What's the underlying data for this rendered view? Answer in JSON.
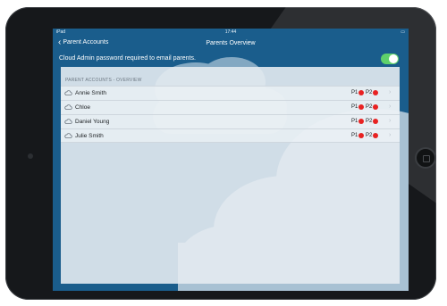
{
  "status_bar": {
    "carrier": "iPad",
    "time": "17:44",
    "battery": ""
  },
  "nav": {
    "back_label": "Parent Accounts",
    "title": "Parents Overview"
  },
  "notice": {
    "text": "Cloud Admin password required to email parents.",
    "toggle_on": true
  },
  "section": {
    "header": "PARENT ACCOUNTS - OVERVIEW"
  },
  "accounts": [
    {
      "name": "Annie Smith",
      "p1_label": "P1",
      "p2_label": "P2",
      "p1_status": "red",
      "p2_status": "red"
    },
    {
      "name": "Chloe",
      "p1_label": "P1",
      "p2_label": "P2",
      "p1_status": "red",
      "p2_status": "red"
    },
    {
      "name": "Daniel Young",
      "p1_label": "P1",
      "p2_label": "P2",
      "p1_status": "red",
      "p2_status": "red"
    },
    {
      "name": "Julie Smith",
      "p1_label": "P1",
      "p2_label": "P2",
      "p1_status": "red",
      "p2_status": "red"
    }
  ],
  "colors": {
    "nav_background": "#1a5d8c",
    "toggle_on": "#5fd16b",
    "status_red": "#e82222",
    "row_background": "#ecf1f5"
  },
  "icons": {
    "row_icon": "cloud-icon",
    "row_disclosure": "chevron-right-icon",
    "back": "chevron-left-icon"
  }
}
